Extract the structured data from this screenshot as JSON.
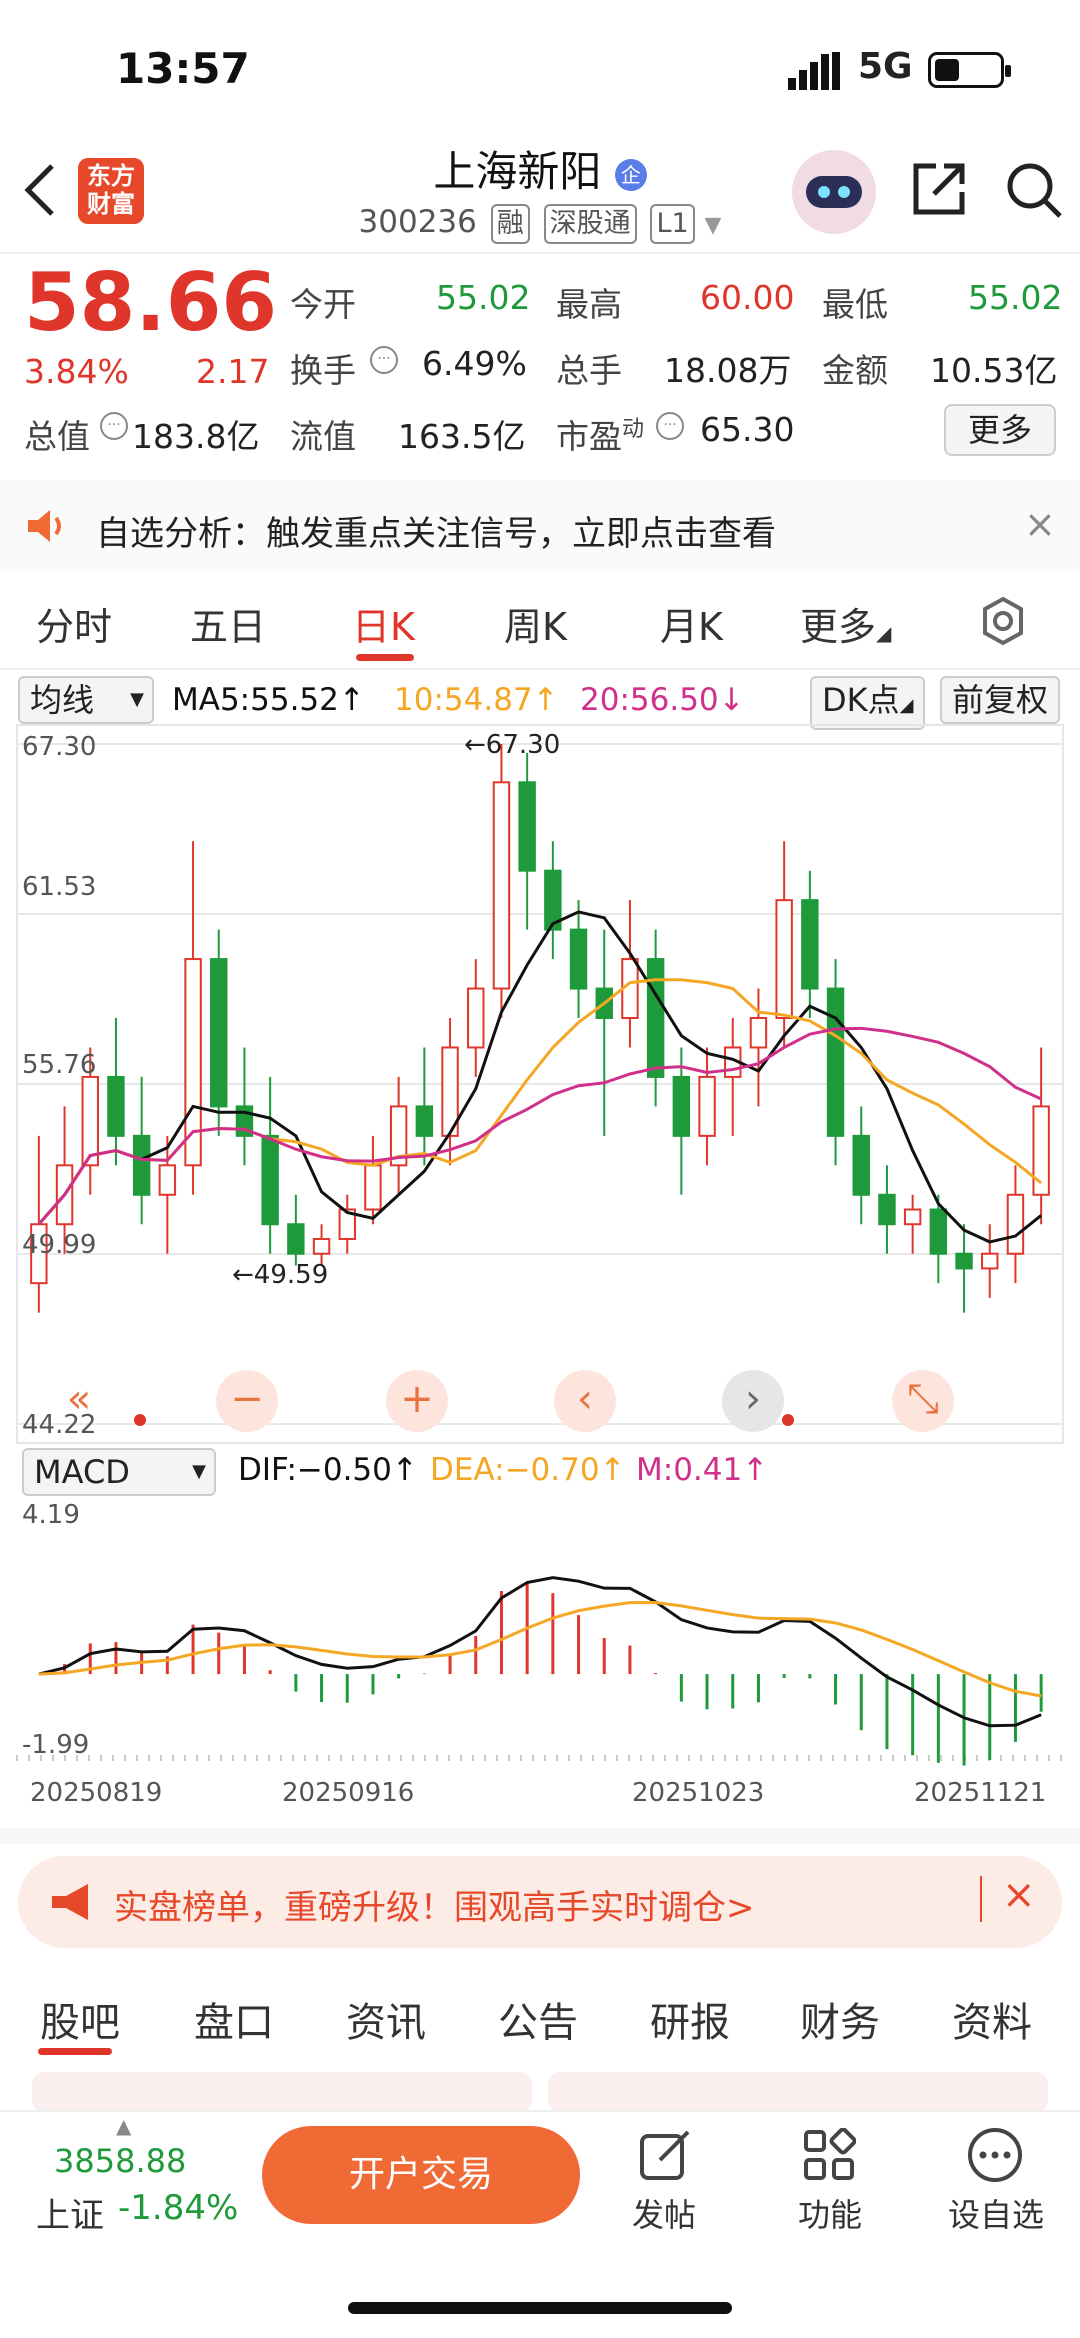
{
  "status_bar": {
    "time": "13:57",
    "network": "5G"
  },
  "header": {
    "title": "上海新阳",
    "code": "300236",
    "tags": [
      "融",
      "深股通",
      "L1"
    ],
    "logo_text": "东方财富"
  },
  "quote": {
    "price": "58.66",
    "change_pct": "3.84%",
    "change": "2.17",
    "open_label": "今开",
    "open": "55.02",
    "high_label": "最高",
    "high": "60.00",
    "low_label": "最低",
    "low": "55.02",
    "turnover_label": "换手",
    "turnover": "6.49%",
    "volume_label": "总手",
    "volume": "18.08万",
    "amount_label": "金额",
    "amount": "10.53亿",
    "total_cap_label": "总值",
    "total_cap": "183.8亿",
    "float_cap_label": "流值",
    "float_cap": "163.5亿",
    "pe_label": "市盈",
    "pe_sup": "动",
    "pe": "65.30",
    "more": "更多"
  },
  "notice": {
    "text": "自选分析：触发重点关注信号，立即点击查看"
  },
  "period_tabs": [
    "分时",
    "五日",
    "日K",
    "周K",
    "月K",
    "更多"
  ],
  "chart_toolbar": {
    "indicator": "均线",
    "ma5": "MA5:55.52",
    "ma10": "10:54.87",
    "ma20": "20:56.50",
    "dk": "DK点",
    "adjust": "前复权"
  },
  "macd_toolbar": {
    "indicator": "MACD",
    "dif": "DIF:−0.50",
    "dea": "DEA:−0.70",
    "m": "M:0.41"
  },
  "banner": {
    "text": "实盘榜单，重磅升级！围观高手实时调仓>"
  },
  "bottom_tabs": [
    "股吧",
    "盘口",
    "资讯",
    "公告",
    "研报",
    "财务",
    "资料"
  ],
  "footer": {
    "index_value": "3858.88",
    "index_name": "上证",
    "index_change": "-1.84%",
    "open_button": "开户交易",
    "post": "发帖",
    "func": "功能",
    "fav": "设自选"
  },
  "colors": {
    "up": "#e0352b",
    "down": "#1e9a3a",
    "ma5": "#111111",
    "ma10": "#f5a623",
    "ma20": "#d0308a"
  },
  "chart_data": {
    "type": "candlestick",
    "price_axis": {
      "ticks": [
        "67.30",
        "61.53",
        "55.76",
        "49.99",
        "44.22"
      ],
      "ylim": [
        44.22,
        67.3
      ]
    },
    "annotations": [
      {
        "text": "67.30"
      },
      {
        "text": "49.59"
      }
    ],
    "x_labels": [
      "20250819",
      "20250916",
      "20251023",
      "20251121"
    ],
    "candles": [
      [
        49,
        54,
        48,
        51
      ],
      [
        51,
        55,
        50,
        53
      ],
      [
        53,
        57,
        52,
        56
      ],
      [
        56,
        58,
        53,
        54
      ],
      [
        54,
        56,
        51,
        52
      ],
      [
        52,
        54,
        50,
        53
      ],
      [
        53,
        64,
        52,
        60
      ],
      [
        60,
        61,
        54,
        55
      ],
      [
        55,
        57,
        53,
        54
      ],
      [
        54,
        56,
        50,
        51
      ],
      [
        51,
        52,
        49.6,
        50
      ],
      [
        50,
        51,
        49.6,
        50.5
      ],
      [
        50.5,
        52,
        50,
        51.5
      ],
      [
        51.5,
        54,
        51,
        53
      ],
      [
        53,
        56,
        52,
        55
      ],
      [
        55,
        57,
        53,
        54
      ],
      [
        54,
        58,
        53,
        57
      ],
      [
        57,
        60,
        56,
        59
      ],
      [
        59,
        67.3,
        58,
        66
      ],
      [
        66,
        67,
        61,
        63
      ],
      [
        63,
        64,
        60,
        61
      ],
      [
        61,
        62,
        58,
        59
      ],
      [
        59,
        61,
        54,
        58
      ],
      [
        58,
        62,
        57,
        60
      ],
      [
        60,
        61,
        55,
        56
      ],
      [
        56,
        57,
        52,
        54
      ],
      [
        54,
        57,
        53,
        56
      ],
      [
        56,
        58,
        54,
        57
      ],
      [
        57,
        59,
        55,
        58
      ],
      [
        58,
        64,
        57,
        62
      ],
      [
        62,
        63,
        58,
        59
      ],
      [
        59,
        60,
        53,
        54
      ],
      [
        54,
        55,
        51,
        52
      ],
      [
        52,
        53,
        50,
        51
      ],
      [
        51,
        52,
        50,
        51.5
      ],
      [
        51.5,
        52,
        49,
        50
      ],
      [
        50,
        51,
        48,
        49.5
      ],
      [
        49.5,
        51,
        48.5,
        50
      ],
      [
        50,
        53,
        49,
        52
      ],
      [
        52,
        57,
        51,
        55
      ]
    ],
    "ma5_last": 55.52,
    "ma10_last": 54.87,
    "ma20_last": 56.5,
    "macd": {
      "ylim": [
        -1.99,
        4.19
      ],
      "dif_last": -0.5,
      "dea_last": -0.7,
      "m_last": 0.41
    }
  }
}
